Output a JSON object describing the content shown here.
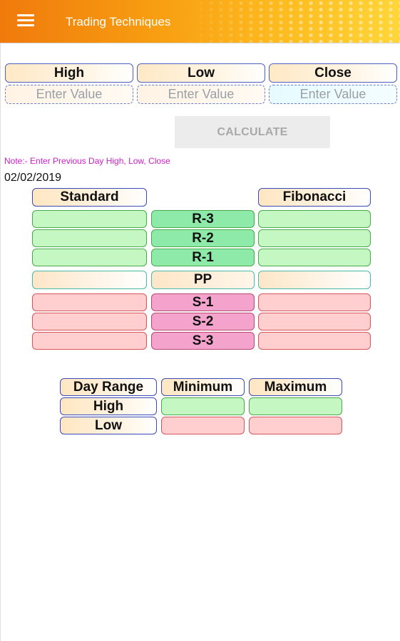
{
  "appbar": {
    "title": "Trading Techniques",
    "menu_icon": "hamburger-menu-icon"
  },
  "inputs": {
    "headers": [
      "High",
      "Low",
      "Close"
    ],
    "placeholder": "Enter Value"
  },
  "calculate_label": "CALCULATE",
  "note": "Note:- Enter Previous Day High, Low, Close",
  "date": "02/02/2019",
  "pivot": {
    "standard_label": "Standard",
    "fibonacci_label": "Fibonacci",
    "rows": [
      "R-3",
      "R-2",
      "R-1",
      "PP",
      "S-1",
      "S-2",
      "S-3"
    ]
  },
  "range": {
    "headers": [
      "Day Range",
      "Minimum",
      "Maximum"
    ],
    "rows": [
      "High",
      "Low"
    ]
  },
  "colors": {
    "appbar_start": "#f07a0c",
    "appbar_end": "#ffd63a",
    "note_text": "#cc1fc9",
    "resistance": "#c5f7c3",
    "support": "#ffcfcf"
  }
}
